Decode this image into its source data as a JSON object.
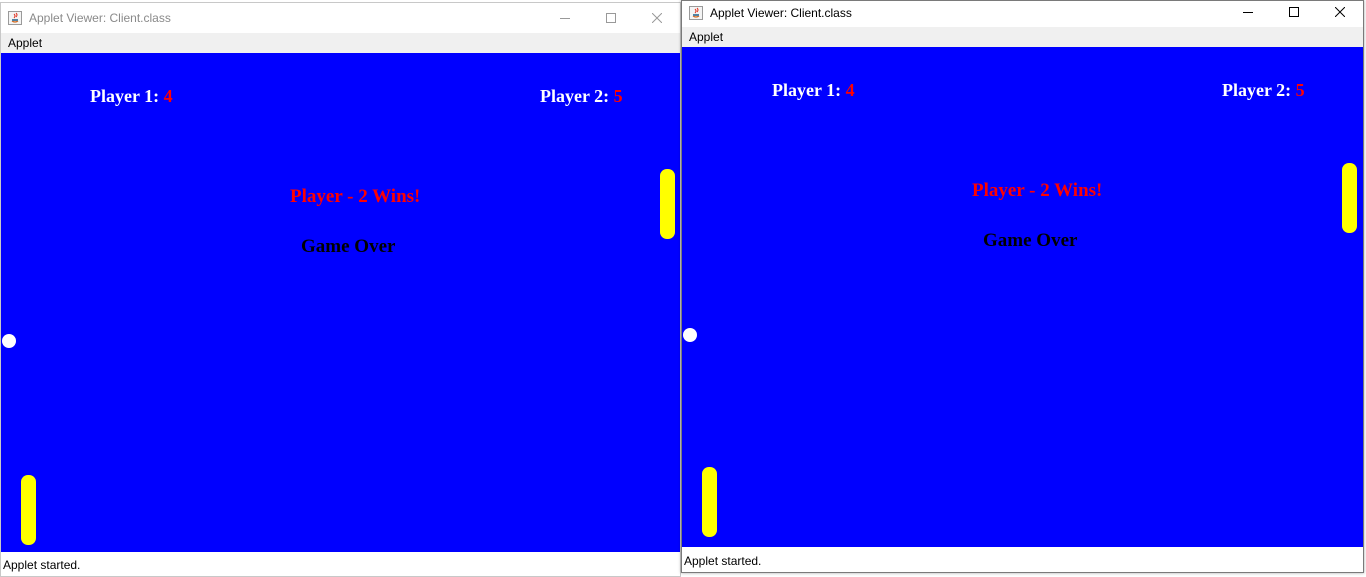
{
  "colors": {
    "game_background": "#0000ff",
    "paddle": "#ffff00",
    "ball": "#ffffff",
    "score_label": "#ffffff",
    "score_value": "#ff0000",
    "win_message": "#ff0000",
    "game_over": "#000000"
  },
  "windows": [
    {
      "title": "Applet Viewer: Client.class",
      "focused": false,
      "title_icon": "java-icon",
      "controls": [
        "minimize-icon",
        "maximize-icon",
        "close-icon"
      ],
      "menu": [
        "Applet"
      ],
      "game": {
        "player1_label": "Player 1:",
        "player1_score": "4",
        "player2_label": "Player 2:",
        "player2_score": "5",
        "win_message": "Player - 2 Wins!",
        "game_over": "Game Over"
      },
      "status": "Applet started."
    },
    {
      "title": "Applet Viewer: Client.class",
      "focused": true,
      "title_icon": "java-icon",
      "controls": [
        "minimize-icon",
        "maximize-icon",
        "close-icon"
      ],
      "menu": [
        "Applet"
      ],
      "game": {
        "player1_label": "Player 1:",
        "player1_score": "4",
        "player2_label": "Player 2:",
        "player2_score": "5",
        "win_message": "Player - 2 Wins!",
        "game_over": "Game Over"
      },
      "status": "Applet started."
    }
  ]
}
